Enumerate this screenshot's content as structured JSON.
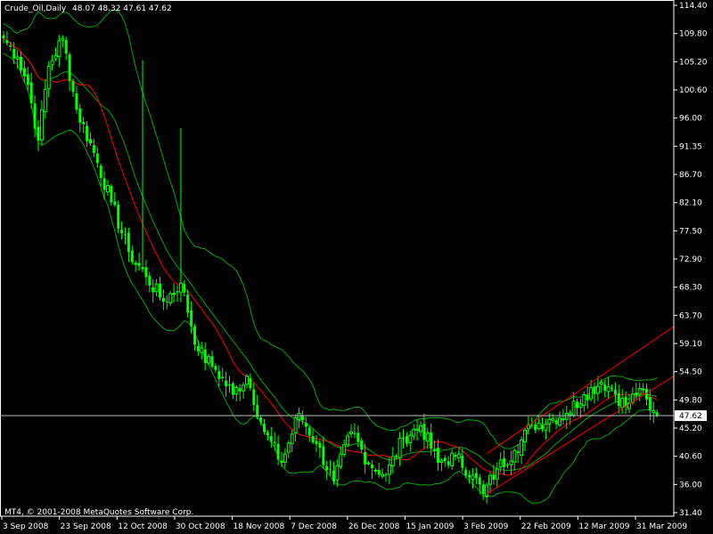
{
  "header": {
    "symbol": "Crude_Oil,Daily",
    "ohlc": "48.07 48.32 47.61 47.62"
  },
  "footer": {
    "copyright": "MT4, © 2001-2008 MetaQuotes Software Corp."
  },
  "colors": {
    "background": "#000000",
    "candles": "#00ff00",
    "moving_average": "#ff0000",
    "bollinger": "#00aa00",
    "channel": "#ff0000",
    "axis": "#ffffff",
    "current_price_line": "#c0c0c0"
  },
  "chart_data": {
    "type": "candlestick",
    "y_ticks": [
      "114.40",
      "109.80",
      "105.20",
      "100.60",
      "96.00",
      "91.35",
      "86.70",
      "82.10",
      "77.50",
      "72.90",
      "68.30",
      "63.70",
      "59.10",
      "54.50",
      "49.80",
      "45.20",
      "40.60",
      "36.00",
      "31.40"
    ],
    "x_ticks": [
      "3 Sep 2008",
      "23 Sep 2008",
      "12 Oct 2008",
      "30 Oct 2008",
      "18 Nov 2008",
      "7 Dec 2008",
      "26 Dec 2008",
      "15 Jan 2009",
      "3 Feb 2009",
      "22 Feb 2009",
      "12 Mar 2009",
      "31 Mar 2009"
    ],
    "ylim": [
      31.4,
      114.4
    ],
    "current_price": "47.62",
    "close_anchors": [
      {
        "bar": 0,
        "close": 108.5
      },
      {
        "bar": 4,
        "close": 105.5
      },
      {
        "bar": 7,
        "close": 101
      },
      {
        "bar": 10,
        "close": 92
      },
      {
        "bar": 13,
        "close": 104
      },
      {
        "bar": 17,
        "close": 108.5
      },
      {
        "bar": 21,
        "close": 97
      },
      {
        "bar": 26,
        "close": 90
      },
      {
        "bar": 31,
        "close": 82
      },
      {
        "bar": 36,
        "close": 74
      },
      {
        "bar": 41,
        "close": 70
      },
      {
        "bar": 46,
        "close": 66
      },
      {
        "bar": 51,
        "close": 69
      },
      {
        "bar": 56,
        "close": 58
      },
      {
        "bar": 61,
        "close": 55
      },
      {
        "bar": 66,
        "close": 51
      },
      {
        "bar": 70,
        "close": 54
      },
      {
        "bar": 75,
        "close": 45
      },
      {
        "bar": 80,
        "close": 40
      },
      {
        "bar": 85,
        "close": 48
      },
      {
        "bar": 90,
        "close": 43
      },
      {
        "bar": 95,
        "close": 37
      },
      {
        "bar": 100,
        "close": 45
      },
      {
        "bar": 105,
        "close": 40
      },
      {
        "bar": 110,
        "close": 38
      },
      {
        "bar": 115,
        "close": 44
      },
      {
        "bar": 120,
        "close": 46
      },
      {
        "bar": 125,
        "close": 40
      },
      {
        "bar": 130,
        "close": 41
      },
      {
        "bar": 135,
        "close": 38
      },
      {
        "bar": 138,
        "close": 35
      },
      {
        "bar": 142,
        "close": 39
      },
      {
        "bar": 147,
        "close": 42
      },
      {
        "bar": 152,
        "close": 46
      },
      {
        "bar": 157,
        "close": 47
      },
      {
        "bar": 162,
        "close": 48
      },
      {
        "bar": 167,
        "close": 51
      },
      {
        "bar": 172,
        "close": 53
      },
      {
        "bar": 175,
        "close": 52
      },
      {
        "bar": 179,
        "close": 49
      },
      {
        "bar": 183,
        "close": 52
      },
      {
        "bar": 186,
        "close": 48.5
      },
      {
        "bar": 188,
        "close": 47.62
      }
    ],
    "spikes": [
      {
        "bar": 40,
        "high": 105
      },
      {
        "bar": 51,
        "high": 94
      }
    ],
    "channel_lines": [
      {
        "from": {
          "bar": 139,
          "price": 35.0
        },
        "to": {
          "bar": 199,
          "price": 54.0
        }
      },
      {
        "from": {
          "bar": 139,
          "price": 41.5
        },
        "to": {
          "bar": 199,
          "price": 62.0
        }
      }
    ],
    "indicators": {
      "moving_average_period": 14,
      "bollinger_period": 20,
      "bollinger_deviations": 2
    }
  }
}
